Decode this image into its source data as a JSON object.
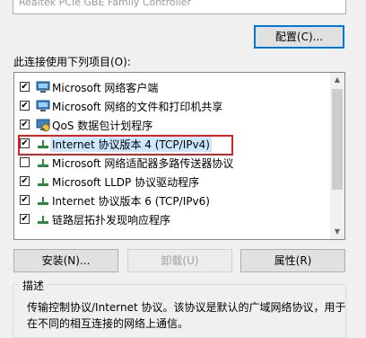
{
  "top_field": {
    "text": "Realtek PCIe GBE Family Controller"
  },
  "configure_button": "配置(C)...",
  "list_label": "此连接使用下列项目(O):",
  "items": [
    {
      "label": "Microsoft 网络客户端",
      "checked": true,
      "icon": "network-client-icon"
    },
    {
      "label": "Microsoft 网络的文件和打印机共享",
      "checked": true,
      "icon": "file-share-icon"
    },
    {
      "label": "QoS 数据包计划程序",
      "checked": true,
      "icon": "qos-icon"
    },
    {
      "label": "Internet 协议版本 4 (TCP/IPv4)",
      "checked": true,
      "icon": "protocol-icon",
      "selected": true
    },
    {
      "label": "Microsoft 网络适配器多路传送器协议",
      "checked": false,
      "icon": "protocol-icon"
    },
    {
      "label": "Microsoft LLDP 协议驱动程序",
      "checked": true,
      "icon": "protocol-icon"
    },
    {
      "label": "Internet 协议版本 6 (TCP/IPv6)",
      "checked": true,
      "icon": "protocol-icon"
    },
    {
      "label": "链路层拓扑发现响应程序",
      "checked": true,
      "icon": "protocol-icon"
    }
  ],
  "buttons": {
    "install": "安装(N)...",
    "uninstall": "卸载(U)",
    "properties": "属性(R)"
  },
  "description": {
    "legend": "描述",
    "text": "传输控制协议/Internet 协议。该协议是默认的广域网络协议，用于在不同的相互连接的网络上通信。"
  },
  "colors": {
    "highlight_box": "#e02020",
    "selection": "#cce8ff",
    "accent": "#0078d7"
  }
}
